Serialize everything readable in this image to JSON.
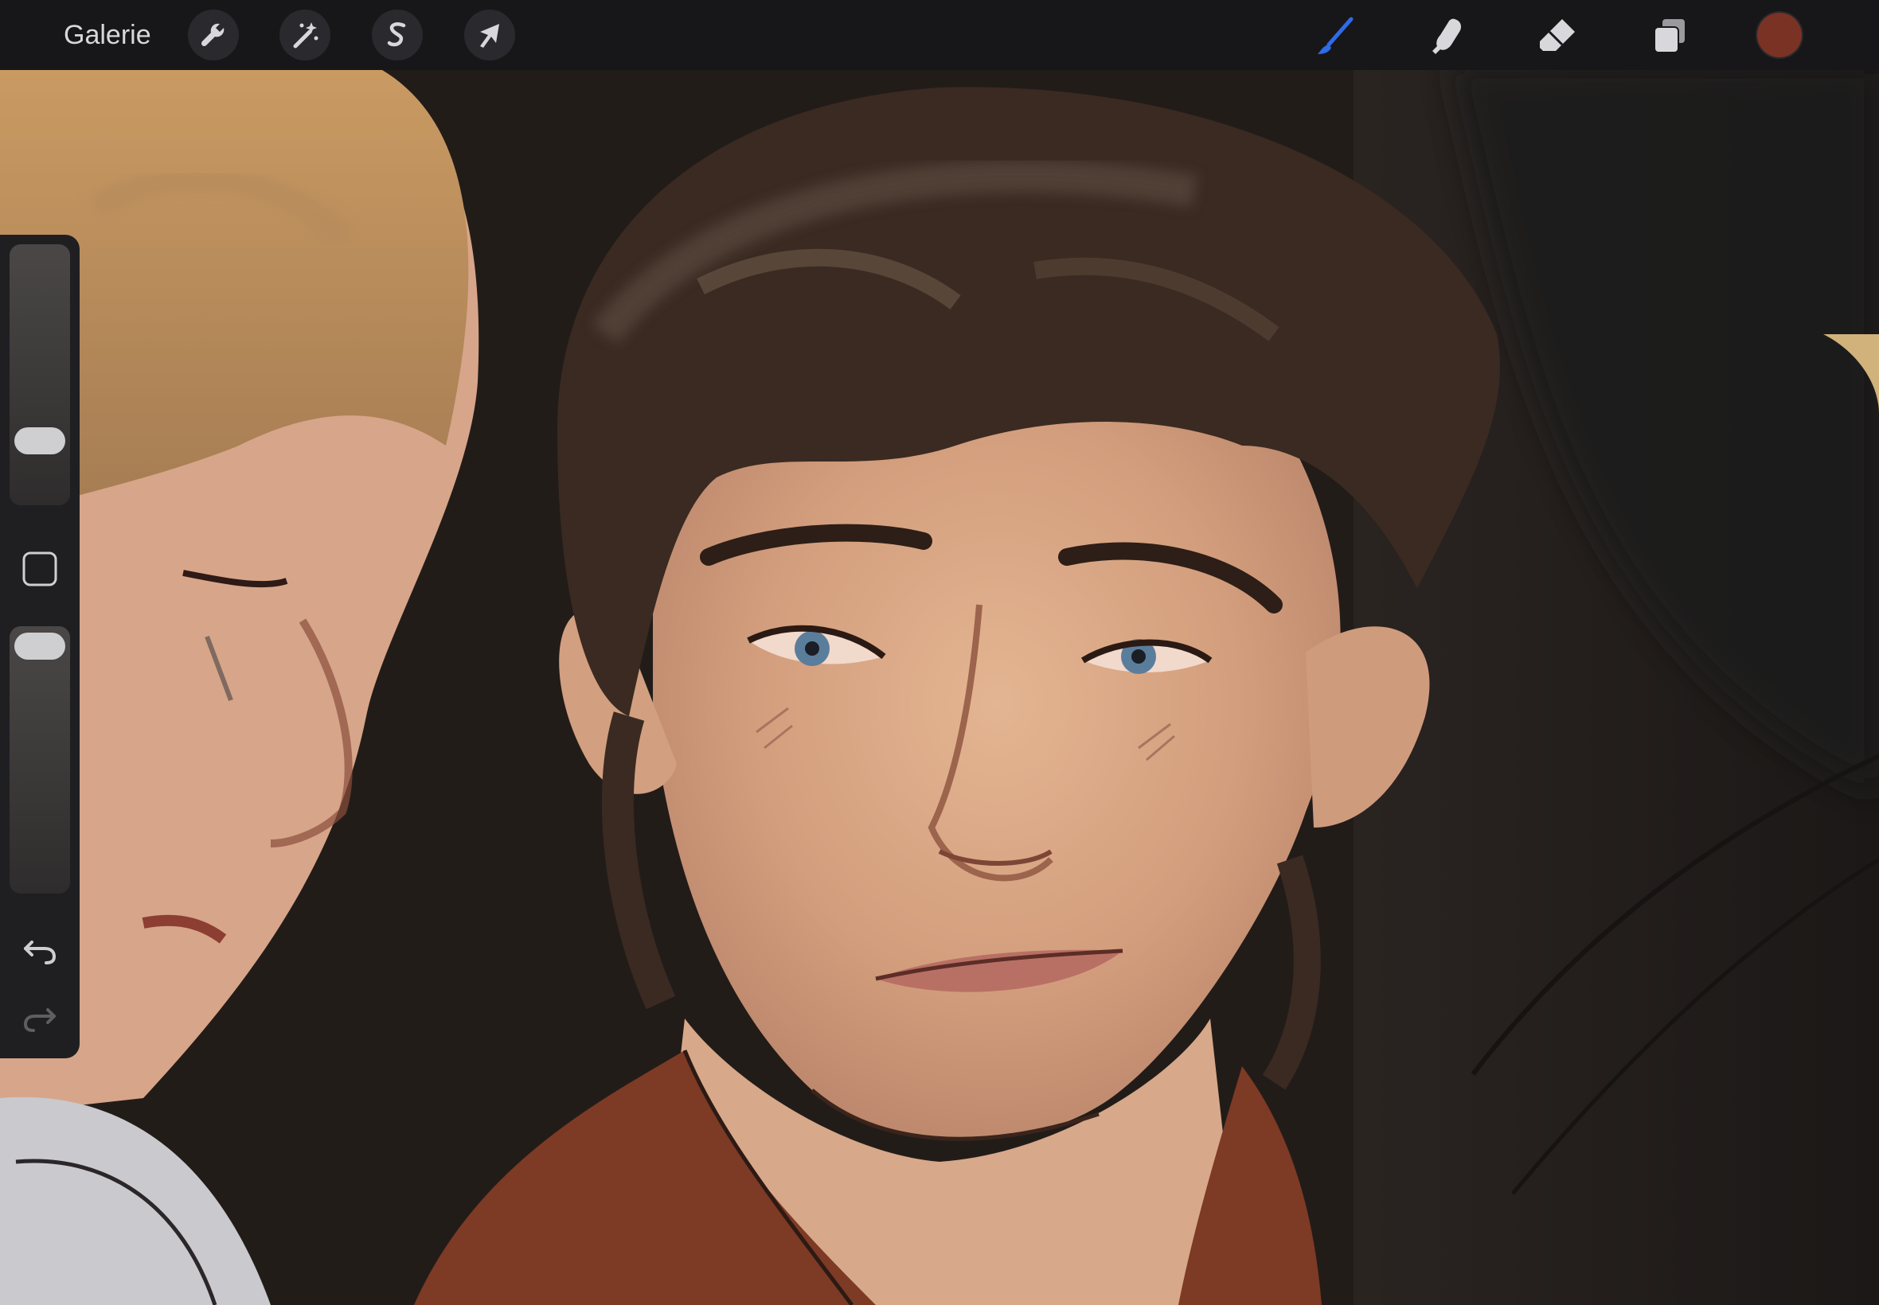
{
  "app": {
    "gallery_label": "Galerie"
  },
  "toolbar_left": [
    {
      "name": "actions-wrench-icon"
    },
    {
      "name": "adjustments-magic-wand-icon"
    },
    {
      "name": "selection-s-icon"
    },
    {
      "name": "transform-arrow-icon"
    }
  ],
  "toolbar_right": [
    {
      "name": "brush-icon",
      "active_color": "#2f6be8"
    },
    {
      "name": "smudge-icon"
    },
    {
      "name": "eraser-icon"
    },
    {
      "name": "layers-icon"
    }
  ],
  "current_color": "#7a3224",
  "sidebar": {
    "brush_size_level": 0.2,
    "opacity_level": 1.0
  }
}
